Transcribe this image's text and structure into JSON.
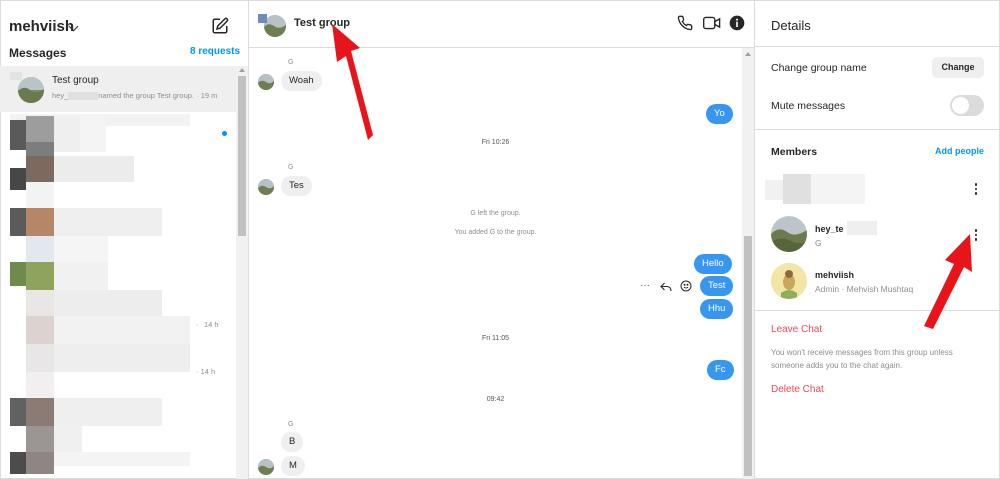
{
  "sidebar": {
    "username": "mehviish",
    "messages_title": "Messages",
    "requests": "8 requests",
    "active_thread": {
      "name": "Test group",
      "preview_prefix": "hey_",
      "preview_suffix": "named the group Test group.",
      "time": "· 19 m"
    },
    "other_times": [
      "14 h",
      "14 h"
    ]
  },
  "chat": {
    "title": "Test group",
    "messages": [
      {
        "sender": "G",
        "text": "Woah",
        "dir": "in"
      },
      {
        "text": "Yo",
        "dir": "out"
      },
      {
        "time": "Fri 10:26"
      },
      {
        "sender": "G",
        "text": "Tes",
        "dir": "in"
      },
      {
        "system": "G left the group."
      },
      {
        "system": "You added G to the group."
      },
      {
        "text": "Hello",
        "dir": "out"
      },
      {
        "text": "Test",
        "dir": "out"
      },
      {
        "text": "Hhu",
        "dir": "out"
      },
      {
        "time": "Fri 11:05"
      },
      {
        "text": "Fc",
        "dir": "out"
      },
      {
        "time": "09:42"
      },
      {
        "sender": "G",
        "text": "B",
        "dir": "in"
      },
      {
        "text": "M",
        "dir": "in"
      }
    ],
    "labels": {
      "m0_sender": "G",
      "m0": "Woah",
      "m1": "Yo",
      "t1": "Fri 10:26",
      "m3_sender": "G",
      "m3": "Tes",
      "s1": "G left the group.",
      "s2": "You added G to the group.",
      "m6": "Hello",
      "m7": "Test",
      "m8": "Hhu",
      "t2": "Fri 11:05",
      "m10": "Fc",
      "t3": "09:42",
      "m12_sender": "G",
      "m12": "B",
      "m13": "M"
    }
  },
  "details": {
    "title": "Details",
    "change_group_name": "Change group name",
    "change_button": "Change",
    "mute_messages": "Mute messages",
    "members_title": "Members",
    "add_people": "Add people",
    "members": [
      {
        "name": "hey_te",
        "sub": "G"
      },
      {
        "name": "mehviish",
        "sub": "Admin · Mehvish Mushtaq"
      }
    ],
    "leave_chat": "Leave Chat",
    "leave_note": "You won't receive messages from this group unless someone adds you to the chat again.",
    "delete_chat": "Delete Chat"
  },
  "colors": {
    "accent": "#0095f6",
    "outgoing_bubble": "#3797f0",
    "incoming_bubble": "#efefef",
    "danger": "#ed4956",
    "annotation_arrow": "#e8141a"
  }
}
